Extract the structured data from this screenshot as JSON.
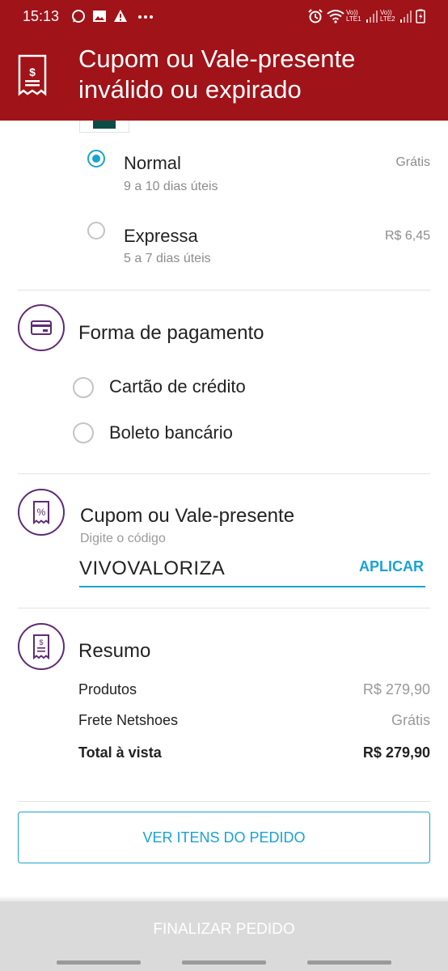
{
  "status_bar": {
    "time": "15:13",
    "sim1": "Vo)) LTE1",
    "sim2": "Vo)) LTE2"
  },
  "banner": {
    "message": "Cupom ou Vale-presente inválido ou expirado",
    "icon": "receipt-dollar-icon"
  },
  "shipping": {
    "options": [
      {
        "label": "Normal",
        "subtitle": "9 a 10 dias úteis",
        "price": "Grátis",
        "selected": true
      },
      {
        "label": "Expressa",
        "subtitle": "5 a 7 dias úteis",
        "price": "R$ 6,45",
        "selected": false
      }
    ]
  },
  "payment": {
    "title": "Forma de pagamento",
    "icon": "credit-card-icon",
    "options": [
      {
        "label": "Cartão de crédito",
        "selected": false
      },
      {
        "label": "Boleto bancário",
        "selected": false
      }
    ]
  },
  "coupon": {
    "title": "Cupom ou Vale-presente",
    "icon": "coupon-percent-icon",
    "hint": "Digite o código",
    "value": "VIVOVALORIZA",
    "apply_label": "APLICAR"
  },
  "summary": {
    "title": "Resumo",
    "icon": "receipt-icon",
    "rows": [
      {
        "label": "Produtos",
        "value": "R$ 279,90"
      },
      {
        "label": "Frete Netshoes",
        "value": "Grátis"
      },
      {
        "label": "Total à vista",
        "value": "R$ 279,90"
      }
    ]
  },
  "actions": {
    "view_items": "VER ITENS DO PEDIDO",
    "finalize": "FINALIZAR PEDIDO"
  },
  "colors": {
    "banner": "#a01318",
    "accent": "#1aa2d4",
    "section_icon": "#5e2b75",
    "finalize_disabled": "#dadada"
  }
}
